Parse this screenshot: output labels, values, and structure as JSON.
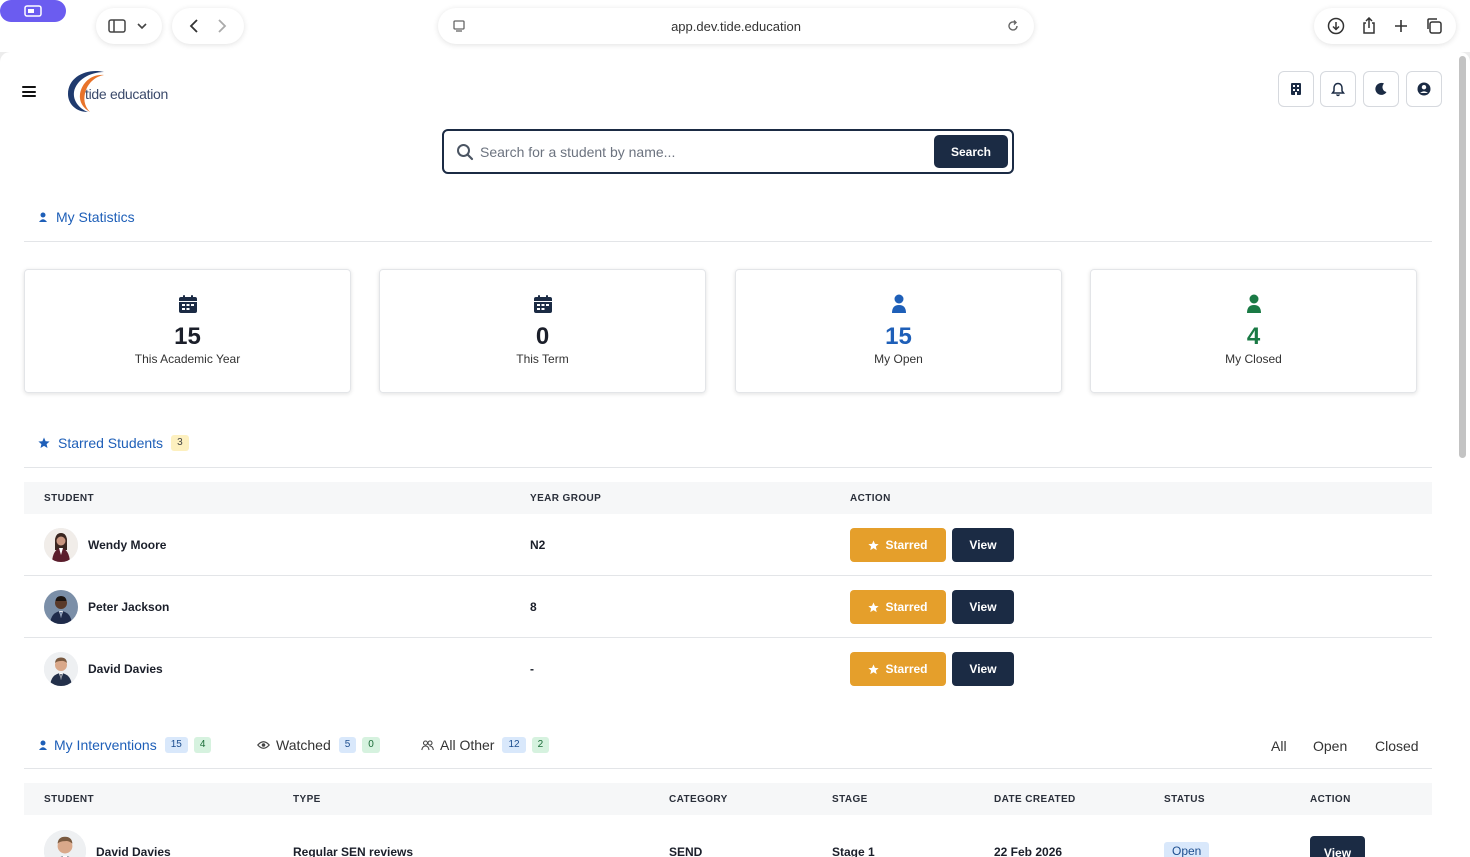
{
  "browser": {
    "url": "app.dev.tide.education"
  },
  "app": {
    "logo_text": "tide education"
  },
  "search": {
    "placeholder": "Search for a student by name...",
    "button_label": "Search"
  },
  "statistics": {
    "heading": "My Statistics",
    "cards": [
      {
        "value": "15",
        "label": "This Academic Year",
        "color": "#111827"
      },
      {
        "value": "0",
        "label": "This Term",
        "color": "#111827"
      },
      {
        "value": "15",
        "label": "My Open",
        "color": "#1e5fb8"
      },
      {
        "value": "4",
        "label": "My Closed",
        "color": "#1a7a45"
      }
    ]
  },
  "starred": {
    "heading": "Starred Students",
    "count": "3",
    "columns": [
      "STUDENT",
      "YEAR GROUP",
      "ACTION"
    ],
    "rows": [
      {
        "name": "Wendy Moore",
        "year": "N2"
      },
      {
        "name": "Peter Jackson",
        "year": "8"
      },
      {
        "name": "David Davies",
        "year": "-"
      }
    ],
    "starred_label": "Starred",
    "view_label": "View"
  },
  "interventions": {
    "tabs": [
      {
        "label": "My Interventions",
        "open": "15",
        "closed": "4"
      },
      {
        "label": "Watched",
        "open": "5",
        "closed": "0"
      },
      {
        "label": "All Other",
        "open": "12",
        "closed": "2"
      }
    ],
    "filters": [
      "All",
      "Open",
      "Closed"
    ],
    "columns": [
      "STUDENT",
      "TYPE",
      "CATEGORY",
      "STAGE",
      "DATE CREATED",
      "STATUS",
      "ACTION"
    ],
    "rows": [
      {
        "student": "David Davies",
        "type": "Regular SEN reviews",
        "category": "SEND",
        "stage": "Stage 1",
        "date": "22 Feb 2026",
        "status": "Open",
        "action": "View"
      }
    ]
  },
  "colors": {
    "primary": "#1b2b44",
    "link": "#1e5fb8",
    "starred": "#e59f2b"
  }
}
